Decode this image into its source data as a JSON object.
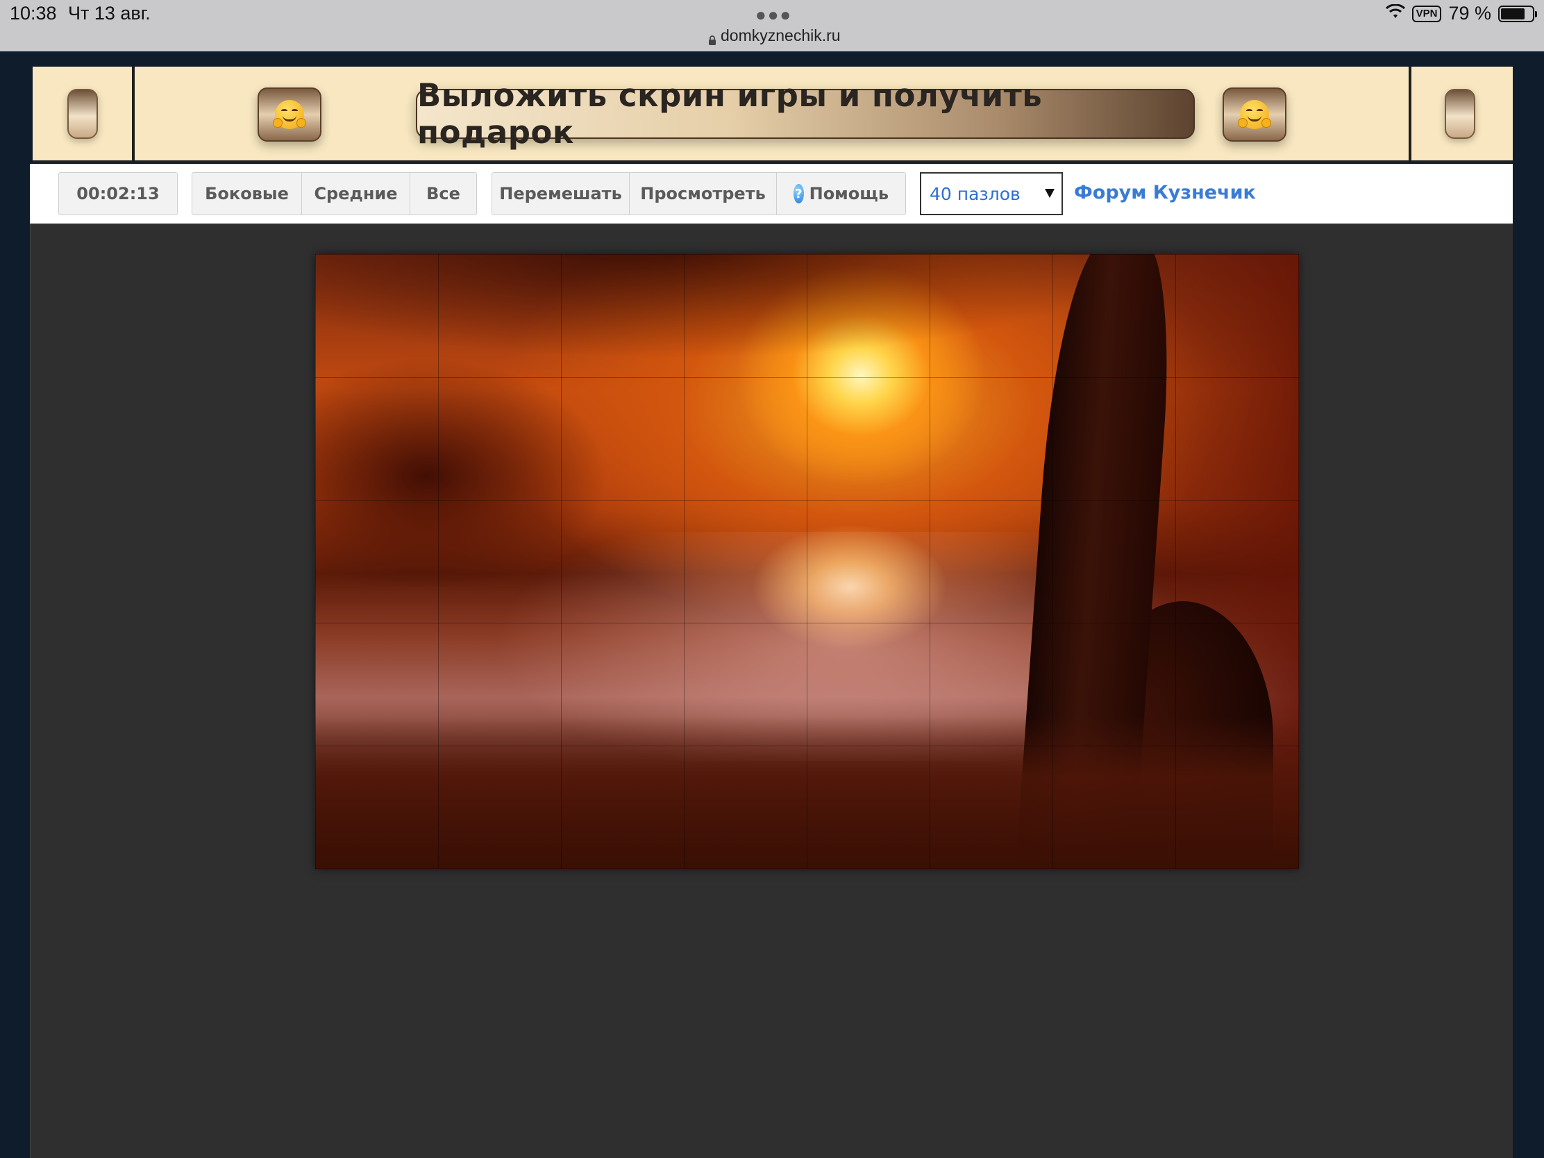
{
  "statusbar": {
    "time": "10:38",
    "date": "Чт 13 авг.",
    "url": "domkyznechik.ru",
    "vpn": "VPN",
    "battery": "79 %"
  },
  "banner": {
    "cta": "Выложить скрин игры и получить подарок"
  },
  "toolbar": {
    "timer": "00:02:13",
    "filters": [
      "Боковые",
      "Средние",
      "Все"
    ],
    "actions": [
      "Перемешать",
      "Просмотреть",
      "Помощь"
    ],
    "help_icon": "?",
    "pieces_select": "40 пазлов",
    "forum_link": "Форум Кузнечик"
  },
  "puzzle": {
    "image": "sunset-over-lake-with-tree",
    "pieces": 40
  }
}
